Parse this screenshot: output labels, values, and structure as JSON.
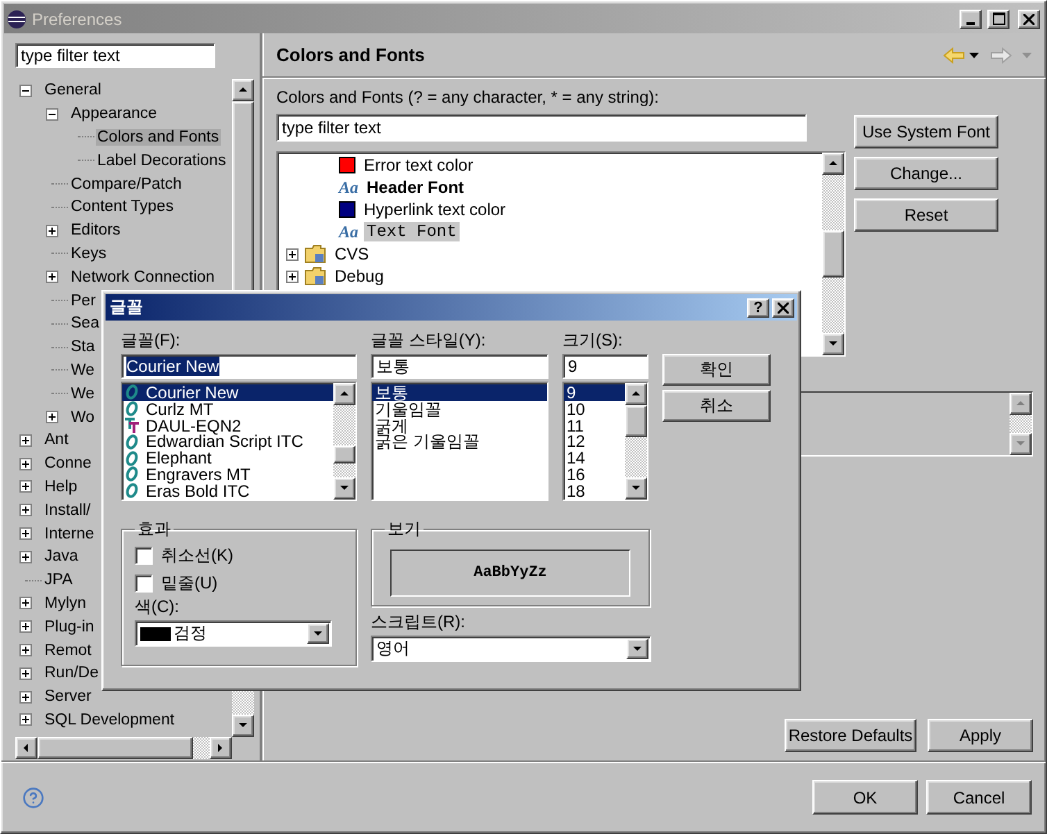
{
  "window": {
    "title": "Preferences"
  },
  "sidebar": {
    "filter": {
      "value": "type filter text"
    },
    "tree": [
      {
        "label": "General",
        "expanded": true,
        "selected": false,
        "children": [
          {
            "label": "Appearance",
            "expanded": true,
            "selected": false,
            "children": [
              {
                "label": "Colors and Fonts",
                "selected": true
              },
              {
                "label": "Label Decorations",
                "selected": false
              }
            ]
          },
          {
            "label": "Compare/Patch",
            "selected": false
          },
          {
            "label": "Content Types",
            "selected": false
          },
          {
            "label": "Editors",
            "expanded": false,
            "selected": false
          },
          {
            "label": "Keys",
            "selected": false
          },
          {
            "label": "Network Connection",
            "expanded": false,
            "selected": false
          },
          {
            "label": "Per",
            "selected": false
          },
          {
            "label": "Sea",
            "selected": false
          },
          {
            "label": "Sta",
            "selected": false
          },
          {
            "label": "We",
            "selected": false
          },
          {
            "label": "We",
            "selected": false
          },
          {
            "label": "Wo",
            "expanded": false,
            "selected": false
          }
        ]
      },
      {
        "label": "Ant",
        "expanded": false,
        "selected": false
      },
      {
        "label": "Conne",
        "expanded": false,
        "selected": false
      },
      {
        "label": "Help",
        "expanded": false,
        "selected": false
      },
      {
        "label": "Install/",
        "expanded": false,
        "selected": false
      },
      {
        "label": "Interne",
        "expanded": false,
        "selected": false
      },
      {
        "label": "Java",
        "expanded": false,
        "selected": false
      },
      {
        "label": "JPA",
        "selected": false
      },
      {
        "label": "Mylyn",
        "expanded": false,
        "selected": false
      },
      {
        "label": "Plug-in",
        "expanded": false,
        "selected": false
      },
      {
        "label": "Remot",
        "expanded": false,
        "selected": false
      },
      {
        "label": "Run/De",
        "expanded": false,
        "selected": false
      },
      {
        "label": "Server",
        "expanded": false,
        "selected": false
      },
      {
        "label": "SQL Development",
        "expanded": false,
        "selected": false
      }
    ]
  },
  "page": {
    "title": "Colors and Fonts",
    "filter_label": "Colors and Fonts (? = any character, * = any string):",
    "filter": {
      "value": "type filter text"
    },
    "items": [
      {
        "kind": "color",
        "label": "Error text color",
        "color": "#ff0000",
        "selected": false
      },
      {
        "kind": "bold_font",
        "icon": "Aa",
        "label": "Header Font",
        "selected": false
      },
      {
        "kind": "color",
        "label": "Hyperlink text color",
        "color": "#000080",
        "selected": false
      },
      {
        "kind": "mono_font",
        "icon": "Aa",
        "label": "Text Font",
        "selected": true
      },
      {
        "kind": "category",
        "label": "CVS",
        "expanded": false,
        "selected": false
      },
      {
        "kind": "category",
        "label": "Debug",
        "expanded": false,
        "selected": false
      }
    ],
    "side_buttons": [
      "Use System Font",
      "Change...",
      "Reset"
    ],
    "page_buttons": [
      "Restore Defaults",
      "Apply"
    ]
  },
  "buttons": [
    "OK",
    "Cancel"
  ],
  "font_dialog": {
    "title": "글꼴",
    "help_button": "?",
    "font": {
      "label": "글꼴(F):",
      "value": "Courier New",
      "options": [
        {
          "label": "Courier New",
          "kind": "opentype",
          "selected": true
        },
        {
          "label": "Curlz MT",
          "kind": "opentype",
          "selected": false
        },
        {
          "label": "DAUL-EQN2",
          "kind": "truetype",
          "selected": false
        },
        {
          "label": "Edwardian Script ITC",
          "kind": "opentype",
          "selected": false
        },
        {
          "label": "Elephant",
          "kind": "opentype",
          "selected": false
        },
        {
          "label": "Engravers MT",
          "kind": "opentype",
          "selected": false
        },
        {
          "label": "Eras Bold ITC",
          "kind": "opentype",
          "selected": false
        }
      ]
    },
    "style": {
      "label": "글꼴 스타일(Y):",
      "value": "보통",
      "options": [
        {
          "label": "보통",
          "selected": true
        },
        {
          "label": "기울임꼴",
          "selected": false
        },
        {
          "label": "굵게",
          "selected": false
        },
        {
          "label": "굵은 기울임꼴",
          "selected": false
        }
      ]
    },
    "size": {
      "label": "크기(S):",
      "value": "9",
      "options": [
        {
          "label": "9",
          "selected": true
        },
        {
          "label": "10",
          "selected": false
        },
        {
          "label": "11",
          "selected": false
        },
        {
          "label": "12",
          "selected": false
        },
        {
          "label": "14",
          "selected": false
        },
        {
          "label": "16",
          "selected": false
        },
        {
          "label": "18",
          "selected": false
        }
      ]
    },
    "buttons": [
      "확인",
      "취소"
    ],
    "effects": {
      "title": "효과",
      "checkboxes": [
        {
          "label": "취소선(K)",
          "checked": false
        },
        {
          "label": "밑줄(U)",
          "checked": false
        }
      ],
      "color_label": "색(C):",
      "color": {
        "label": "검정",
        "color": "#000000"
      }
    },
    "preview": {
      "title": "보기",
      "sample": "AaBbYyZz"
    },
    "script": {
      "label": "스크립트(R):",
      "value": "영어"
    }
  }
}
